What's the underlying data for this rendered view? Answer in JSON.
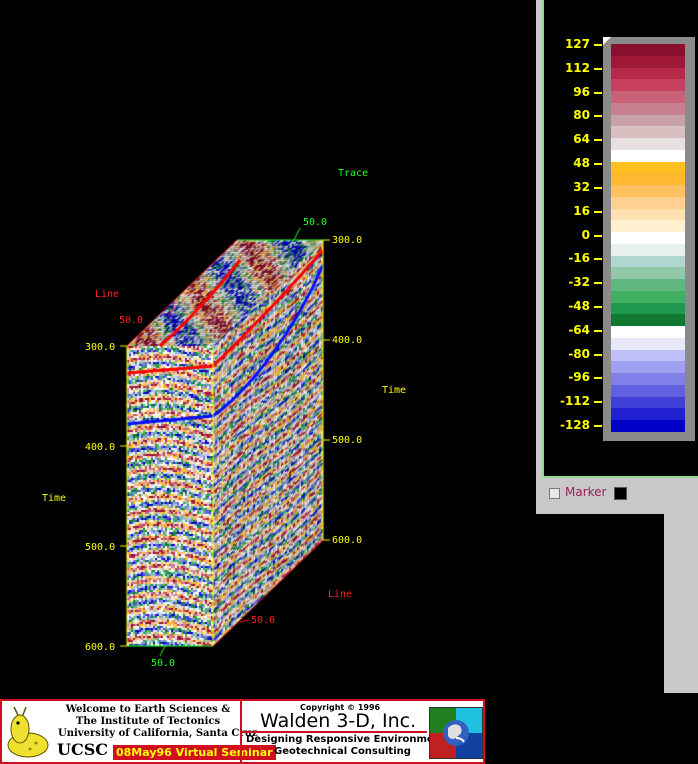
{
  "volume": {
    "labels": {
      "trace_axis": "Trace",
      "line_axis_left": "Line",
      "line_axis_right": "Line",
      "time_axis_left": "Time",
      "time_axis_right": "Time"
    },
    "ticks": {
      "top_trace": "50.0",
      "top_line": "50.0",
      "front_time": [
        "300.0",
        "400.0",
        "500.0",
        "600.0"
      ],
      "back_time": [
        "300.0",
        "400.0",
        "500.0",
        "600.0"
      ],
      "bottom_trace": "50.0",
      "bottom_line": "50.0"
    },
    "colors": {
      "axis_front": "#ffff00",
      "axis_line": "#ff2020",
      "axis_trace": "#20ff20"
    }
  },
  "colorbar": {
    "tick_labels": [
      "127",
      "112",
      "96",
      "80",
      "64",
      "48",
      "32",
      "16",
      "0",
      "-16",
      "-32",
      "-48",
      "-64",
      "-80",
      "-96",
      "-112",
      "-128"
    ],
    "palette": [
      "#8b1030",
      "#a01838",
      "#b82848",
      "#c84060",
      "#c86078",
      "#c88090",
      "#c8a0a8",
      "#d8c0c0",
      "#e8e0e0",
      "#ffffff",
      "#ffc020",
      "#ffb830",
      "#ffc060",
      "#ffd090",
      "#ffe0b0",
      "#fff0d0",
      "#ffffff",
      "#e8f0f0",
      "#b0d8d0",
      "#90c8a8",
      "#60b880",
      "#40b060",
      "#209850",
      "#107830",
      "#ffffff",
      "#e8e8f8",
      "#c0c0f8",
      "#a0a0f0",
      "#8080e8",
      "#6060e0",
      "#4040d8",
      "#2020d0",
      "#0000c8"
    ],
    "marker_label": "Marker",
    "colors": {
      "label": "#ffff00",
      "marker_text": "#a0205a"
    }
  },
  "banner": {
    "welcome_line1": "Welcome to Earth Sciences &",
    "welcome_line2": "The Institute of Tectonics",
    "welcome_line3": "University of California, Santa Cruz",
    "ucsc": "UCSC",
    "seminar": "08May96 Virtual Seminar",
    "copyright": "Copyright © 1996",
    "company": "Walden 3-D, Inc.",
    "tagline1": "Designing Responsive Environments",
    "tagline2": "Geotechnical Consulting",
    "colors": {
      "border": "#d01020",
      "seminar_bg": "#d01020",
      "seminar_text": "#ffff00"
    }
  }
}
